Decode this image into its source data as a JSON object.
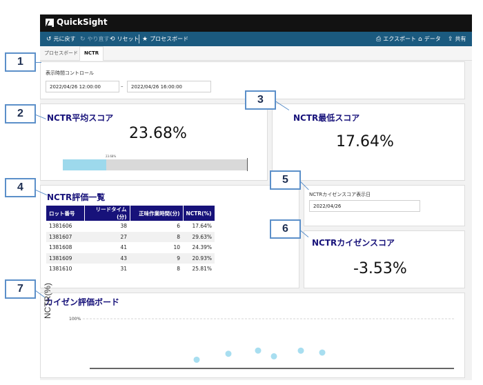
{
  "app": {
    "title": "QuickSight"
  },
  "toolbar": {
    "undo": "元に戻す",
    "redo": "やり直す",
    "reset": "リセット",
    "publish": "プロセスボード",
    "export": "エクスポート",
    "data": "データ",
    "share": "共有"
  },
  "tabs": [
    {
      "label": "プロセスボード",
      "active": false
    },
    {
      "label": "NCTR",
      "active": true
    }
  ],
  "callouts": [
    "1",
    "2",
    "3",
    "4",
    "5",
    "6",
    "7"
  ],
  "time_control": {
    "label": "表示時間コントロール",
    "start": "2022/04/26 12:00:00",
    "separator": "–",
    "end": "2022/04/26 16:00:00"
  },
  "avg_score": {
    "title": "NCTR平均スコア",
    "value": "23.68%",
    "bar_label": "23.68%",
    "bar_fraction": 0.2368
  },
  "min_score": {
    "title": "NCTR最低スコア",
    "value": "17.64%"
  },
  "eval_list": {
    "title": "NCTR評価一覧",
    "columns": [
      "ロット番号",
      "リードタイム(分)",
      "正味作業時間(分)",
      "NCTR(%)"
    ],
    "rows": [
      [
        "1381606",
        "38",
        "6",
        "17.64%"
      ],
      [
        "1381607",
        "27",
        "8",
        "29.63%"
      ],
      [
        "1381608",
        "41",
        "10",
        "24.39%"
      ],
      [
        "1381609",
        "43",
        "9",
        "20.93%"
      ],
      [
        "1381610",
        "31",
        "8",
        "25.81%"
      ]
    ]
  },
  "kaizen_date": {
    "label": "NCTRカイゼンスコア表示日",
    "value": "2022/04/26"
  },
  "kaizen_score": {
    "title": "NCTRカイゼンスコア",
    "value": "-3.53%"
  },
  "kaizen_board": {
    "title": "カイゼン評価ボード"
  },
  "chart_data": {
    "type": "scatter",
    "ylabel": "NCTR(%)",
    "y_tick": "100%",
    "points": [
      {
        "x": 1,
        "y": 17.6
      },
      {
        "x": 2,
        "y": 29.6
      },
      {
        "x": 3,
        "y": 36.0
      },
      {
        "x": 4,
        "y": 24.4
      },
      {
        "x": 5,
        "y": 35.8
      },
      {
        "x": 6,
        "y": 32.0
      }
    ],
    "ylim": [
      0,
      100
    ],
    "grid": true,
    "point_color": "#a8def0"
  }
}
